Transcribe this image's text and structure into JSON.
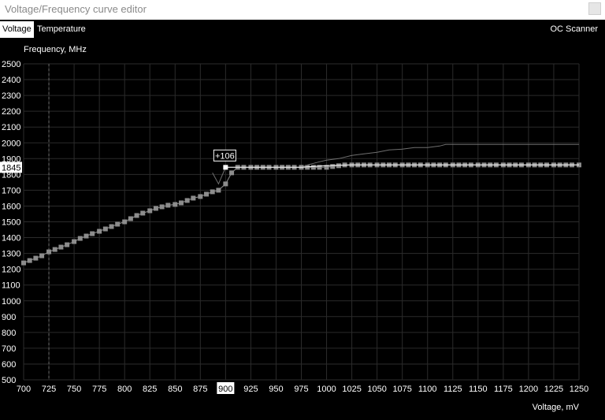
{
  "window": {
    "title": "Voltage/Frequency curve editor"
  },
  "tabs": [
    {
      "label": "Voltage",
      "active": true
    },
    {
      "label": "Temperature",
      "active": false
    }
  ],
  "oc_scanner_label": "OC Scanner",
  "chart_data": {
    "type": "line",
    "ylabel": "Frequency, MHz",
    "xlabel": "Voltage, mV",
    "xlim": [
      700,
      1250
    ],
    "ylim": [
      500,
      2500
    ],
    "x_ticks": [
      700,
      725,
      750,
      775,
      800,
      825,
      850,
      875,
      900,
      925,
      950,
      975,
      1000,
      1025,
      1050,
      1075,
      1100,
      1125,
      1150,
      1175,
      1200,
      1225,
      1250
    ],
    "y_ticks": [
      500,
      600,
      700,
      800,
      900,
      1000,
      1100,
      1200,
      1300,
      1400,
      1500,
      1600,
      1700,
      1800,
      1900,
      2000,
      2100,
      2200,
      2300,
      2400,
      2500
    ],
    "grid": true,
    "selected_voltage_label": "900",
    "selected_frequency_label": "1845",
    "offset_label": "+106",
    "reference_voltage": 725,
    "series": [
      {
        "style": "points",
        "color": "#8c8c8c",
        "x": [
          700,
          706,
          712,
          718,
          725,
          731,
          737,
          743,
          750,
          756,
          762,
          768,
          775,
          781,
          787,
          793,
          800,
          806,
          812,
          818,
          825,
          831,
          837,
          843,
          850,
          856,
          862,
          868,
          875,
          881,
          887,
          893,
          900,
          906,
          912,
          918,
          925,
          931,
          937,
          943,
          950,
          956,
          962,
          968,
          975,
          981,
          987,
          993,
          1000,
          1006,
          1012,
          1018,
          1025,
          1031,
          1037,
          1043,
          1050,
          1056,
          1062,
          1068,
          1075,
          1081,
          1087,
          1093,
          1100,
          1106,
          1112,
          1118,
          1125,
          1131,
          1137,
          1143,
          1150,
          1156,
          1162,
          1168,
          1175,
          1181,
          1187,
          1193,
          1200,
          1206,
          1212,
          1218,
          1225,
          1231,
          1237,
          1243,
          1250
        ],
        "y": [
          1240,
          1255,
          1270,
          1285,
          1310,
          1325,
          1340,
          1355,
          1375,
          1395,
          1410,
          1425,
          1440,
          1455,
          1470,
          1485,
          1500,
          1520,
          1540,
          1555,
          1570,
          1585,
          1595,
          1605,
          1610,
          1620,
          1635,
          1650,
          1660,
          1675,
          1690,
          1700,
          1740,
          1810,
          1845,
          1845,
          1845,
          1845,
          1845,
          1845,
          1845,
          1845,
          1845,
          1845,
          1845,
          1845,
          1845,
          1845,
          1845,
          1850,
          1855,
          1860,
          1860,
          1860,
          1860,
          1860,
          1860,
          1860,
          1860,
          1860,
          1860,
          1860,
          1860,
          1860,
          1860,
          1860,
          1860,
          1860,
          1860,
          1860,
          1860,
          1860,
          1860,
          1860,
          1860,
          1860,
          1860,
          1860,
          1860,
          1860,
          1860,
          1860,
          1860,
          1860,
          1860,
          1860,
          1860,
          1860,
          1860
        ]
      },
      {
        "style": "line",
        "color": "#6f6f6f",
        "x": [
          887,
          893,
          900,
          906,
          925,
          950,
          975,
          981,
          987,
          993,
          1000,
          1012,
          1025,
          1037,
          1050,
          1062,
          1075,
          1087,
          1100,
          1112,
          1118,
          1125,
          1150,
          1175,
          1200,
          1225,
          1250
        ],
        "y": [
          1810,
          1740,
          1845,
          1845,
          1845,
          1845,
          1845,
          1860,
          1870,
          1880,
          1890,
          1900,
          1920,
          1930,
          1940,
          1955,
          1960,
          1970,
          1970,
          1980,
          1990,
          1990,
          1990,
          1990,
          1990,
          1990,
          1990
        ]
      },
      {
        "style": "line",
        "color": "#ffffff",
        "x": [
          900,
          925,
          950,
          975,
          1000,
          1025,
          1050,
          1075,
          1100,
          1125,
          1150,
          1175,
          1200,
          1225,
          1250
        ],
        "y": [
          1845,
          1845,
          1845,
          1845,
          1855,
          1860,
          1860,
          1860,
          1860,
          1860,
          1860,
          1860,
          1860,
          1860,
          1860
        ]
      }
    ]
  }
}
